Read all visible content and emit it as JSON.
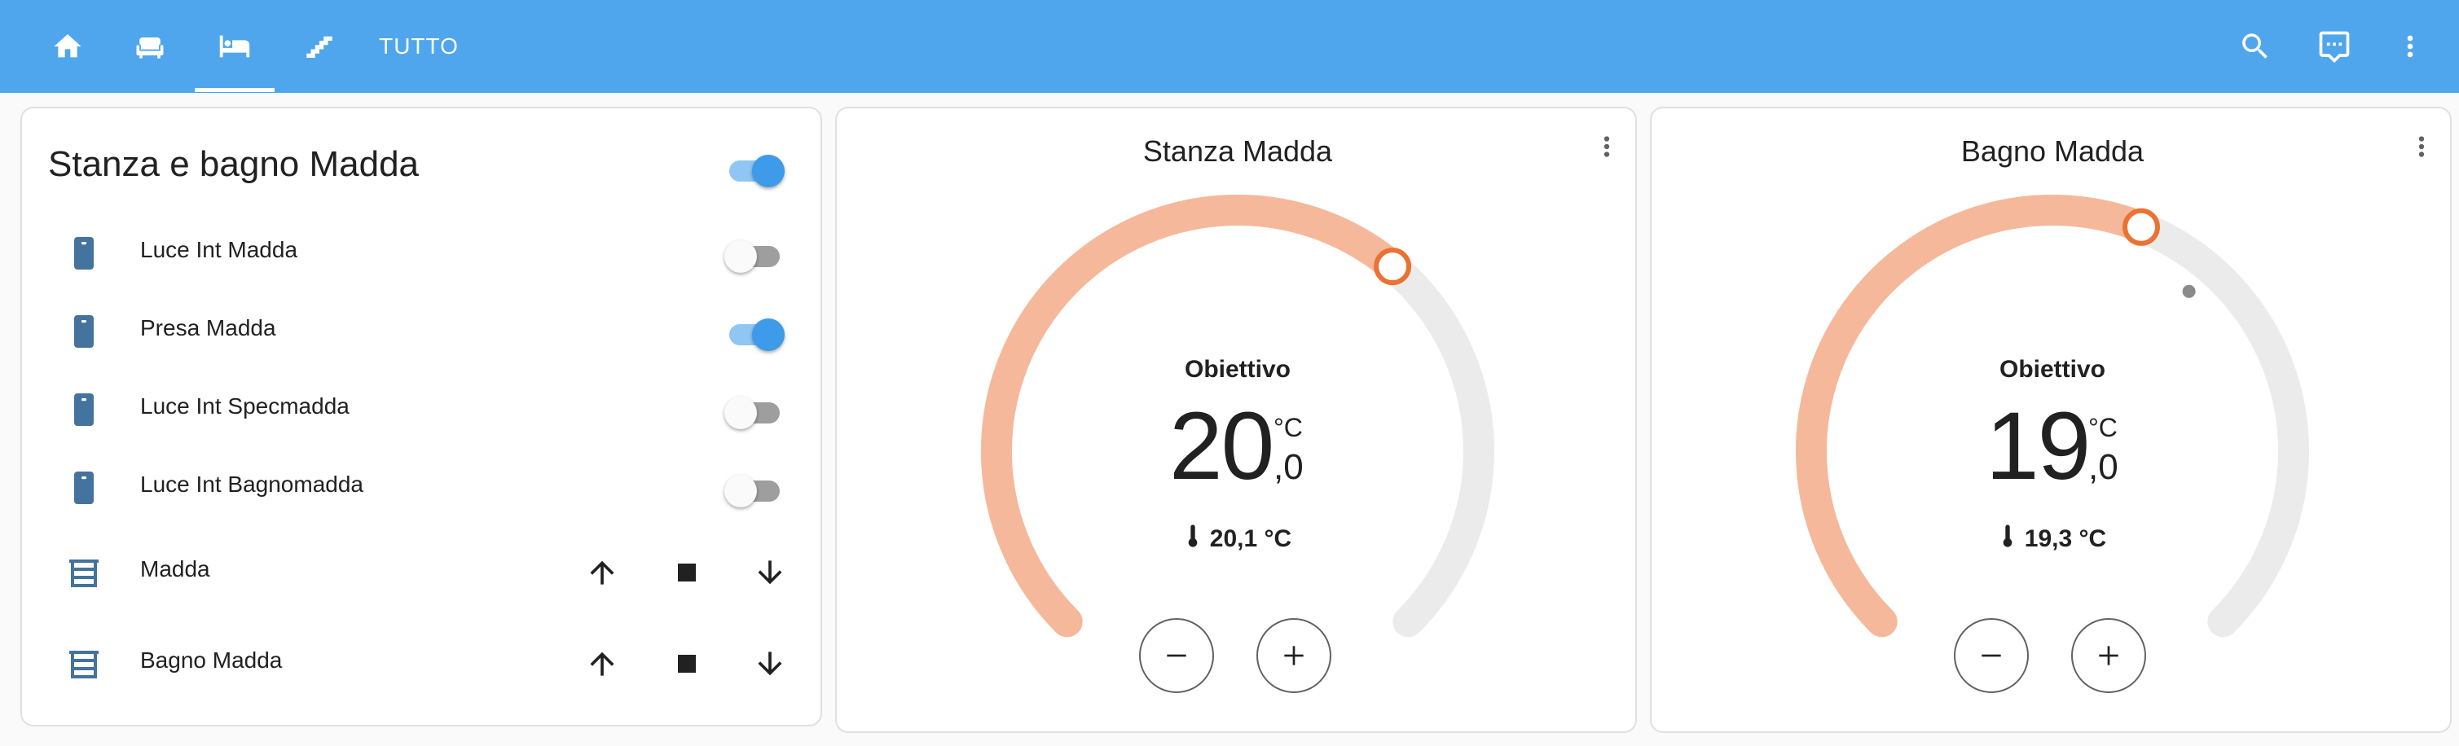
{
  "topbar": {
    "tabs": [
      {
        "icon": "home-icon"
      },
      {
        "icon": "sofa-icon"
      },
      {
        "icon": "bed-icon",
        "selected": true
      },
      {
        "icon": "stairs-icon"
      },
      {
        "label": "TUTTO"
      }
    ],
    "actions": [
      "search-icon",
      "chat-icon",
      "more-vert-icon"
    ],
    "color": "#4fa6ec"
  },
  "entities_card": {
    "title": "Stanza e bagno Madda",
    "header_toggle_on": true,
    "rows": [
      {
        "label": "Luce Int Madda",
        "icon": "power-socket-icon",
        "on": false
      },
      {
        "label": "Presa Madda",
        "icon": "power-socket-icon",
        "on": true
      },
      {
        "label": "Luce Int Specmadda",
        "icon": "power-socket-icon",
        "on": false
      },
      {
        "label": "Luce Int Bagnomadda",
        "icon": "power-socket-icon",
        "on": false
      }
    ],
    "covers": [
      {
        "label": "Madda",
        "icon": "window-shutter-icon"
      },
      {
        "label": "Bagno Madda",
        "icon": "window-shutter-icon"
      }
    ]
  },
  "thermostats": [
    {
      "title": "Stanza Madda",
      "target_label": "Obiettivo",
      "target_int": "20",
      "target_dec": ",0",
      "unit": "°C",
      "current": "20,1 °C",
      "target_fraction": 0.648
    },
    {
      "title": "Bagno Madda",
      "target_label": "Obiettivo",
      "target_int": "19",
      "target_dec": ",0",
      "unit": "°C",
      "current": "19,3 °C",
      "target_fraction": 0.58,
      "current_fraction": 0.65
    }
  ],
  "colors": {
    "accent": "#3d9be9",
    "heat_arc": "#f6b89a",
    "heat_handle": "#ea7232",
    "icon_blue": "#44739e"
  }
}
